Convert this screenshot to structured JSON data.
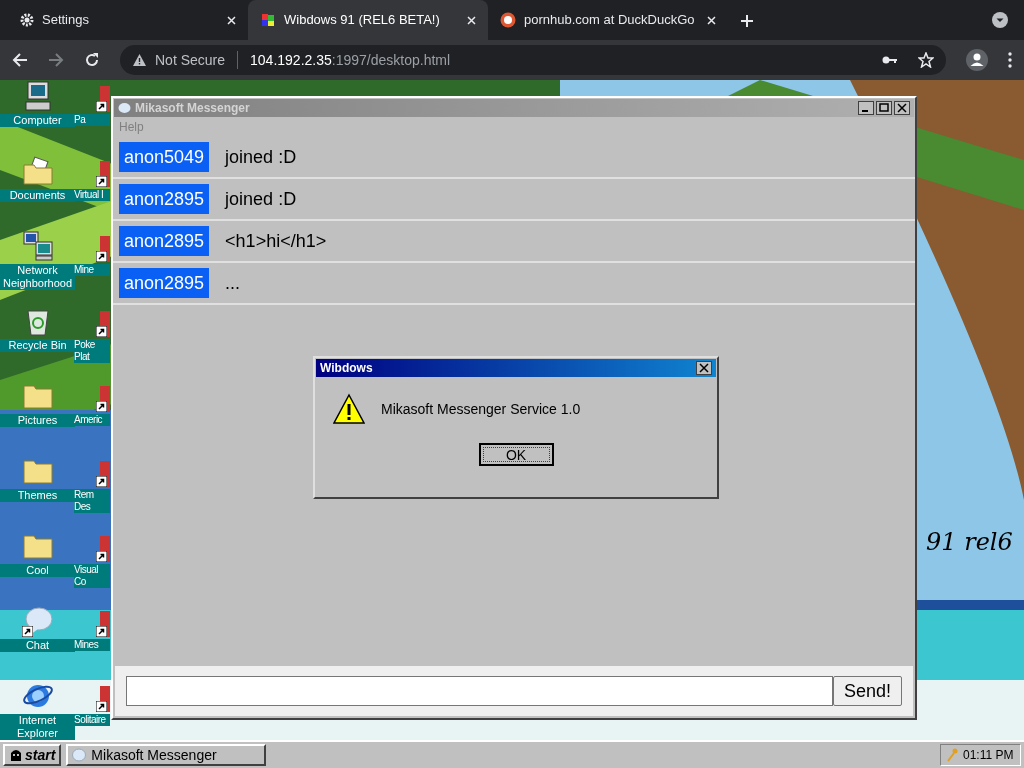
{
  "browser": {
    "tabs": [
      {
        "title": "Settings",
        "kind": "settings",
        "selected": false
      },
      {
        "title": "Wibdows 91 (REL6 BETA!)",
        "kind": "site",
        "selected": true
      },
      {
        "title": "pornhub.com at DuckDuckGo",
        "kind": "search",
        "selected": false
      }
    ],
    "address": {
      "security": "Not Secure",
      "host": "104.192.2.35",
      "path": ":1997/desktop.html"
    }
  },
  "desktop": {
    "icons": [
      {
        "label": "Computer",
        "kind": "computer",
        "shortcut": false
      },
      {
        "label": "Documents",
        "kind": "documents",
        "shortcut": false
      },
      {
        "label": "Network Neighborhood",
        "kind": "network",
        "shortcut": false
      },
      {
        "label": "Recycle Bin",
        "kind": "recycle",
        "shortcut": false
      },
      {
        "label": "Pictures",
        "kind": "folder",
        "shortcut": false
      },
      {
        "label": "Themes",
        "kind": "folder",
        "shortcut": false
      },
      {
        "label": "Cool",
        "kind": "folder",
        "shortcut": false
      },
      {
        "label": "Chat",
        "kind": "chat",
        "shortcut": true
      },
      {
        "label": "Internet Explorer",
        "kind": "browser",
        "shortcut": false
      }
    ],
    "icons_column_2": [
      {
        "label": "Pa",
        "shortcut": true
      },
      {
        "label": "Virtual I",
        "shortcut": true
      },
      {
        "label": "Mine",
        "shortcut": true
      },
      {
        "label": "Poke Plat",
        "shortcut": true
      },
      {
        "label": "Americ",
        "shortcut": true
      },
      {
        "label": "Rem Des",
        "shortcut": true
      },
      {
        "label": "Visual Co",
        "shortcut": true
      },
      {
        "label": "Mines",
        "shortcut": true
      },
      {
        "label": "Solitaire",
        "shortcut": true
      }
    ],
    "wallpaper_text": "91 rel6"
  },
  "messenger": {
    "title": "Mikasoft Messenger",
    "active": false,
    "menu": [
      "Help"
    ],
    "messages": [
      {
        "user": "anon5049",
        "text": "joined :D"
      },
      {
        "user": "anon2895",
        "text": "joined :D"
      },
      {
        "user": "anon2895",
        "text": "<h1>hi</h1>"
      },
      {
        "user": "anon2895",
        "text": "..."
      }
    ],
    "send_button": "Send!"
  },
  "dialog": {
    "title": "Wibdows",
    "message": "Mikasoft Messenger Service 1.0",
    "ok_button": "OK"
  },
  "taskbar": {
    "start": "start",
    "tasks": [
      {
        "label": "Mikasoft Messenger"
      }
    ],
    "clock": "01:11 PM"
  }
}
